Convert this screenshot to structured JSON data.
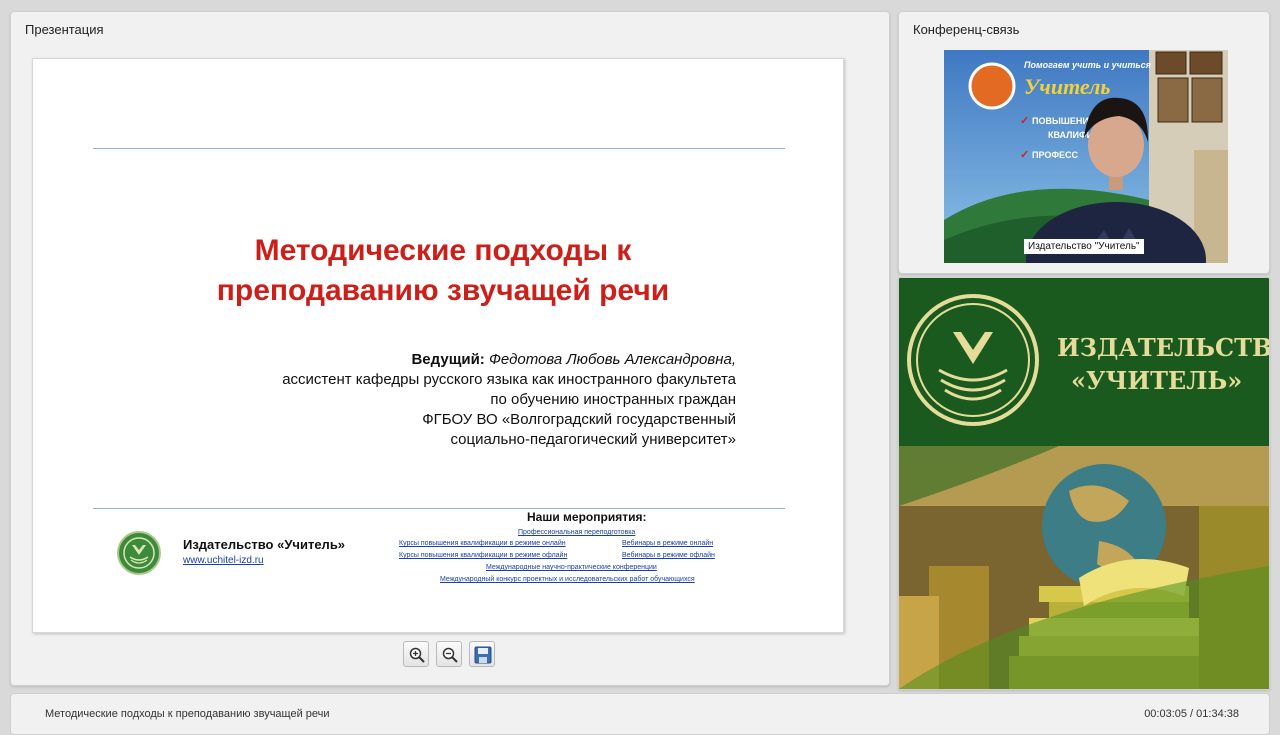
{
  "panels": {
    "presentation_title": "Презентация",
    "conference_title": "Конференц-связь"
  },
  "slide": {
    "title_line1": "Методические подходы к",
    "title_line2": "преподаванию звучащей речи",
    "presenter_label": "Ведущий:",
    "presenter_name": "Федотова Любовь Александровна,",
    "presenter_line2": "ассистент кафедры русского языка как иностранного факультета",
    "presenter_line3": "по обучению иностранных граждан",
    "presenter_line4": "ФГБОУ ВО «Волгоградский государственный",
    "presenter_line5": "социально-педагогический университет»",
    "publisher_name": "Издательство «Учитель»",
    "publisher_url": "www.uchitel-izd.ru",
    "events_title": "Наши мероприятия:",
    "events": [
      "Профессиональная переподготовка",
      "Курсы повышения квалификации в режиме онлайн",
      "Вебинары в режиме онлайн",
      "Курсы повышения квалификации в режиме офлайн",
      "Вебинары в режиме офлайн",
      "Международные научно-практические конференции",
      "Международный конкурс проектных и исследовательских работ обучающихся"
    ]
  },
  "toolbar": {
    "zoom_in_icon": "zoom-in-icon",
    "zoom_out_icon": "zoom-out-icon",
    "save_icon": "floppy-disk-icon"
  },
  "video": {
    "caption": "Издательство \"Учитель\"",
    "banner_line1": "Помогаем учить и учиться",
    "banner_word": "Учитель",
    "banner_item1": "ПОВЫШЕНИЕ",
    "banner_item2": "КВАЛИФИК",
    "banner_item3": "ПРОФЕСС"
  },
  "brand": {
    "line1": "ИЗДАТЕЛЬСТВО",
    "line2": "«УЧИТЕЛЬ»",
    "colors": {
      "green": "#1a5a1f",
      "gold": "#e6dc9a"
    }
  },
  "bottom_bar": {
    "title": "Методические подходы к преподаванию звучащей речи",
    "time": "00:03:05 / 01:34:38"
  },
  "colors": {
    "title_red": "#cc1f1a",
    "link_blue": "#1a3fa8"
  }
}
